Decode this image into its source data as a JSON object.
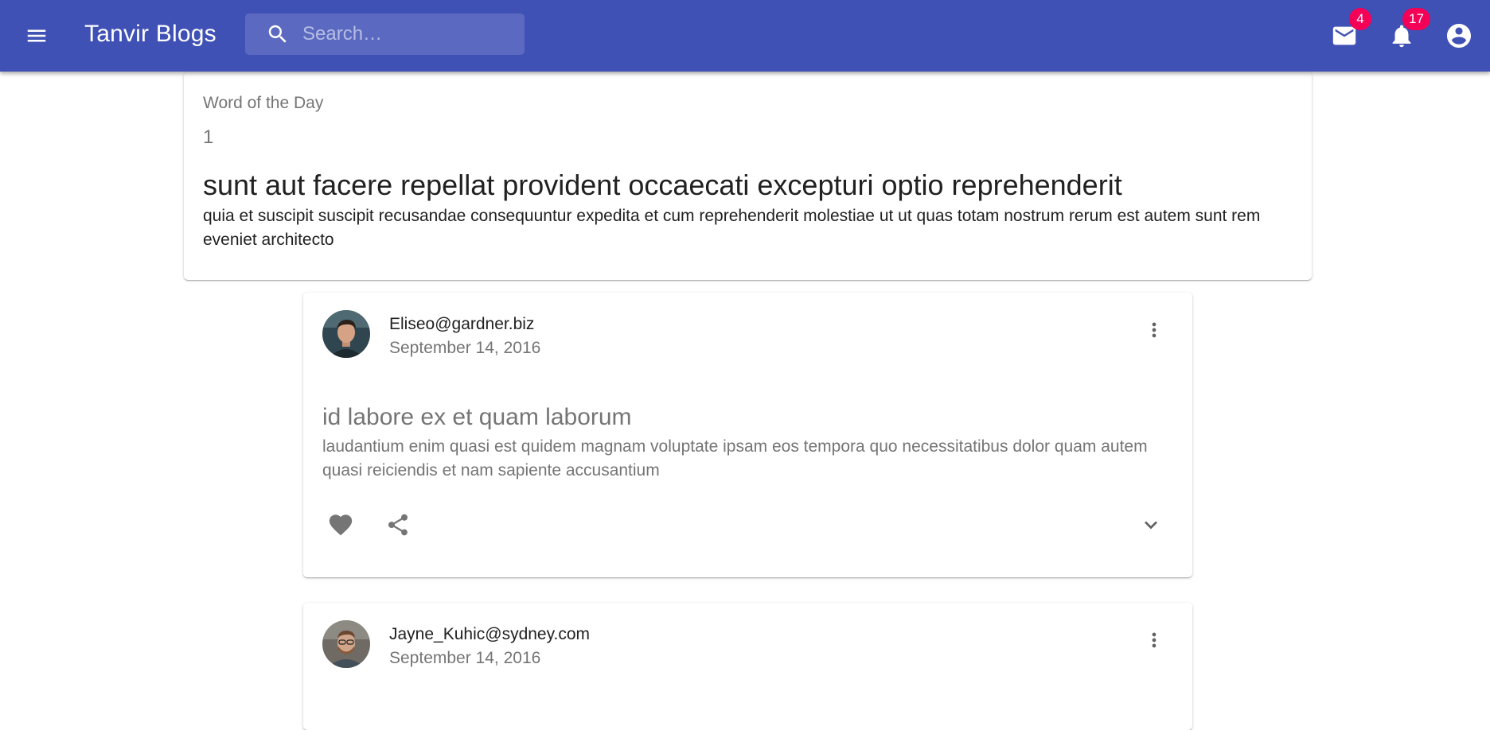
{
  "appbar": {
    "title": "Tanvir Blogs",
    "search_placeholder": "Search…",
    "mail_badge": "4",
    "notifications_badge": "17",
    "colors": {
      "primary": "#3f51b5",
      "badge": "#f50057"
    }
  },
  "word_of_the_day": {
    "overline": "Word of the Day",
    "number": "1",
    "title": "sunt aut facere repellat provident occaecati excepturi optio reprehenderit",
    "body": "quia et suscipit suscipit recusandae consequuntur expedita et cum reprehenderit molestiae ut ut quas totam nostrum rerum est autem sunt rem eveniet architecto"
  },
  "posts": [
    {
      "author": "Eliseo@gardner.biz",
      "date": "September 14, 2016",
      "title": "id labore ex et quam laborum",
      "body": "laudantium enim quasi est quidem magnam voluptate ipsam eos tempora quo necessitatibus dolor quam autem quasi reiciendis et nam sapiente accusantium",
      "actions": [
        "favorite-icon",
        "share-icon",
        "expand-icon"
      ]
    },
    {
      "author": "Jayne_Kuhic@sydney.com",
      "date": "September 14, 2016"
    }
  ]
}
